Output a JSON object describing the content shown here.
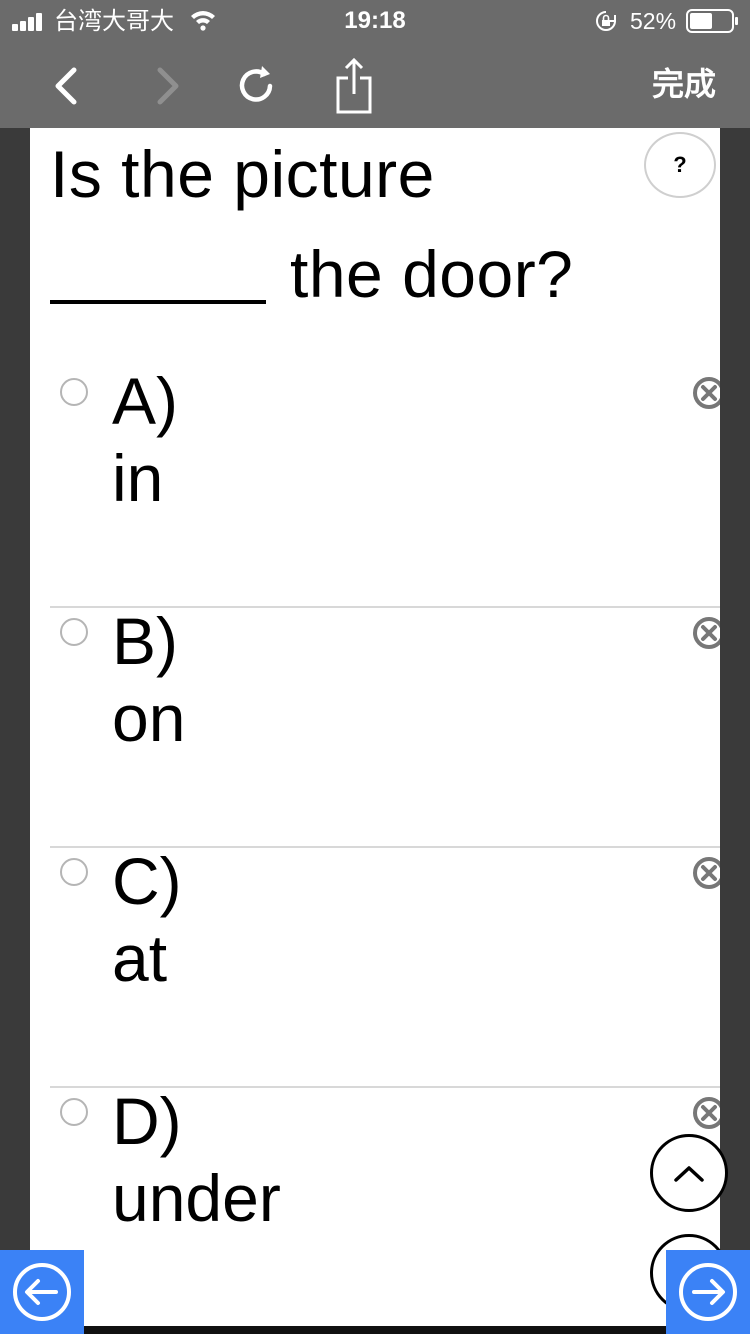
{
  "status_bar": {
    "carrier": "台湾大哥大",
    "time": "19:18",
    "battery_percent": "52%",
    "battery_level": 0.52
  },
  "toolbar": {
    "done_label": "完成"
  },
  "question": {
    "line1": "Is the picture",
    "line2": "the door?",
    "help_label": "?"
  },
  "options": [
    {
      "letter": "A)",
      "text": "in"
    },
    {
      "letter": "B)",
      "text": "on"
    },
    {
      "letter": "C)",
      "text": "at"
    },
    {
      "letter": "D)",
      "text": "under"
    }
  ],
  "colors": {
    "toolbar_bg": "#6b6b6b",
    "gutter": "#3a3a3a",
    "nav_button": "#3b82f6"
  },
  "icons": {
    "back": "chevron-left-icon",
    "forward": "chevron-right-icon",
    "reload": "reload-icon",
    "share": "share-icon",
    "remove": "close-circle-icon",
    "scroll_top": "chevron-up-icon",
    "prev": "arrow-left-circle-icon",
    "next": "arrow-right-circle-icon"
  }
}
